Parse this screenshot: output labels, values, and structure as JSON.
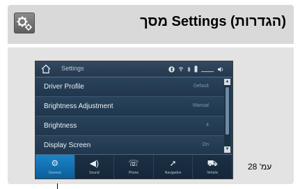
{
  "header": {
    "title": "מסך Settings (הגדרות)",
    "icon": "gears-icon"
  },
  "screen": {
    "status_title": "Settings",
    "icons": [
      "home-icon",
      "bluetooth-icon",
      "wifi-icon",
      "battery-icon",
      "signal-icon",
      "volume-icon"
    ],
    "rows": [
      {
        "label": "Driver Profile",
        "value": "Default"
      },
      {
        "label": "Brightness Adjustment",
        "value": "Manual"
      },
      {
        "label": "Brightness",
        "value": "4"
      },
      {
        "label": "Display Screen",
        "value": "On"
      }
    ],
    "tabs": [
      {
        "label": "General",
        "icon": "gear-icon",
        "active": true
      },
      {
        "label": "Sound",
        "icon": "speaker-icon",
        "active": false
      },
      {
        "label": "Phone",
        "icon": "phone-icon",
        "active": false
      },
      {
        "label": "Navigation",
        "icon": "navigation-icon",
        "active": false
      },
      {
        "label": "Vehicle",
        "icon": "car-icon",
        "active": false
      }
    ]
  },
  "footer": {
    "page_label": "עמ' 28"
  },
  "colors": {
    "card": "#e3e3e3",
    "screen_bg": "#243d55",
    "active_tab": "#1b84c8"
  }
}
